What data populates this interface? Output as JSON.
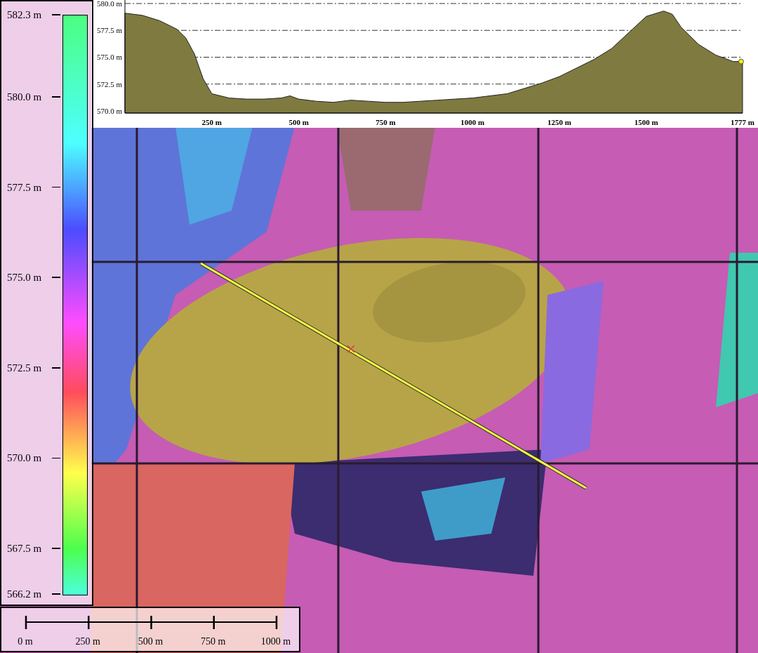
{
  "profile": {
    "chart_data": {
      "type": "area",
      "grid": true,
      "x": [
        0,
        50,
        100,
        150,
        175,
        200,
        225,
        250,
        300,
        350,
        400,
        450,
        475,
        500,
        550,
        600,
        650,
        700,
        750,
        800,
        850,
        900,
        950,
        1000,
        1050,
        1100,
        1150,
        1200,
        1250,
        1300,
        1350,
        1400,
        1450,
        1500,
        1550,
        1575,
        1600,
        1650,
        1700,
        1750,
        1777
      ],
      "series": [
        {
          "color": "#7f7a40",
          "values": [
            579.1,
            578.9,
            578.4,
            577.6,
            576.8,
            575.3,
            573.0,
            571.6,
            571.2,
            571.1,
            571.1,
            571.2,
            571.4,
            571.1,
            570.9,
            570.8,
            571.0,
            570.9,
            570.8,
            570.8,
            570.9,
            571.0,
            571.1,
            571.2,
            571.4,
            571.6,
            572.1,
            572.6,
            573.2,
            574.0,
            574.8,
            575.8,
            577.3,
            578.8,
            579.3,
            579.0,
            577.8,
            576.2,
            575.2,
            574.6,
            574.6
          ]
        }
      ],
      "xlim": [
        0,
        1777
      ],
      "ylim": [
        569.8,
        580
      ],
      "xticks": [
        {
          "value": 250,
          "label": "250 m"
        },
        {
          "value": 500,
          "label": "500 m"
        },
        {
          "value": 750,
          "label": "750 m"
        },
        {
          "value": 1000,
          "label": "1000 m"
        },
        {
          "value": 1250,
          "label": "1250 m"
        },
        {
          "value": 1500,
          "label": "1500 m"
        },
        {
          "value": 1777,
          "label": "1777 m"
        }
      ],
      "yticks": [
        {
          "value": 570,
          "label": "570.0 m"
        },
        {
          "value": 572.5,
          "label": "572.5 m"
        },
        {
          "value": 575,
          "label": "575.0 m"
        },
        {
          "value": 577.5,
          "label": "577.5 m"
        },
        {
          "value": 580,
          "label": "580.0 m"
        }
      ]
    }
  },
  "legend": {
    "labels": [
      "582.3 m",
      "580.0 m",
      "577.5 m",
      "575.0 m",
      "572.5 m",
      "570.0 m",
      "567.5 m",
      "566.2 m"
    ]
  },
  "scale_bar": {
    "labels": [
      "0 m",
      "250 m",
      "500 m",
      "750 m",
      "1000 m"
    ]
  }
}
